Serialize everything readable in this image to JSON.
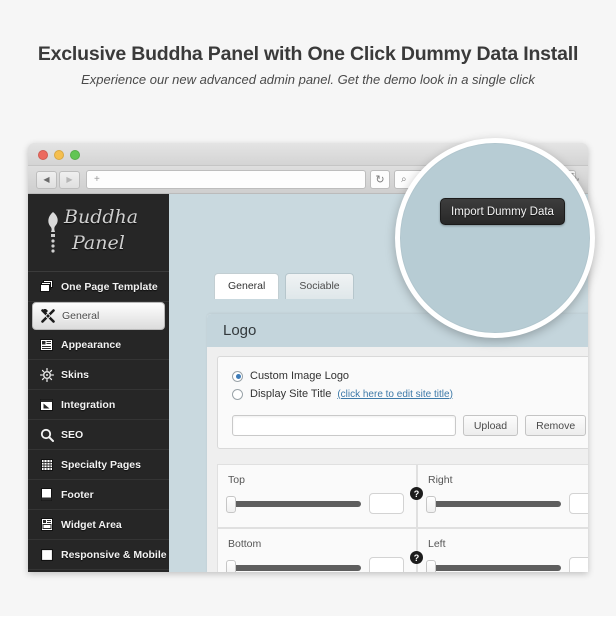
{
  "header": {
    "headline": "Exclusive Buddha Panel with One Click Dummy Data Install",
    "subhead": "Experience our new advanced admin panel. Get the demo look in a single click"
  },
  "browser": {
    "back_icon": "◀",
    "forward_icon": "▶",
    "url_value": "+",
    "reload_icon": "↻",
    "search_icon": "⌕",
    "search_value": "",
    "expand_icon": "⤡"
  },
  "sidebar": {
    "logo_line1": "Buddha",
    "logo_line2": "Panel",
    "items": [
      {
        "label": "One Page Template",
        "icon": "stack-icon",
        "active": false
      },
      {
        "label": "General",
        "icon": "wrench-icon",
        "active": true
      },
      {
        "label": "Appearance",
        "icon": "layout-icon",
        "active": false
      },
      {
        "label": "Skins",
        "icon": "sun-icon",
        "active": false
      },
      {
        "label": "Integration",
        "icon": "window-cursor-icon",
        "active": false
      },
      {
        "label": "SEO",
        "icon": "search-icon",
        "active": false
      },
      {
        "label": "Specialty Pages",
        "icon": "grid-icon",
        "active": false
      },
      {
        "label": "Footer",
        "icon": "page-icon",
        "active": false
      },
      {
        "label": "Widget Area",
        "icon": "widget-icon",
        "active": false
      },
      {
        "label": "Responsive & Mobile",
        "icon": "square-icon",
        "active": false
      }
    ]
  },
  "main": {
    "tabs": [
      {
        "label": "General",
        "active": true
      },
      {
        "label": "Sociable",
        "active": false
      }
    ],
    "section_title": "Logo",
    "radios": [
      {
        "label": "Custom Image Logo",
        "selected": true,
        "link": ""
      },
      {
        "label": "Display Site Title",
        "selected": false,
        "link": "(click here to edit site title)"
      }
    ],
    "logo_path_value": "",
    "upload_label": "Upload",
    "remove_label": "Remove",
    "image_icon": "image-icon",
    "sliders": [
      {
        "label": "Top",
        "value": "",
        "position": 0,
        "help": "?"
      },
      {
        "label": "Right",
        "value": "",
        "position": 0,
        "help": ""
      },
      {
        "label": "Bottom",
        "value": "",
        "position": 0,
        "help": "?"
      },
      {
        "label": "Left",
        "value": "",
        "position": 0,
        "help": ""
      }
    ]
  },
  "magnifier": {
    "button_label": "Import Dummy Data"
  },
  "colors": {
    "page_bg": "#f6f6f6",
    "sidebar_bg": "#262626",
    "viewport_bg": "#c9d9df",
    "panel_head_bg": "#c4d5dc",
    "magnifier_fill": "#b7ccd4",
    "link": "#3d79a8",
    "radio_accent": "#3c7bb8"
  }
}
